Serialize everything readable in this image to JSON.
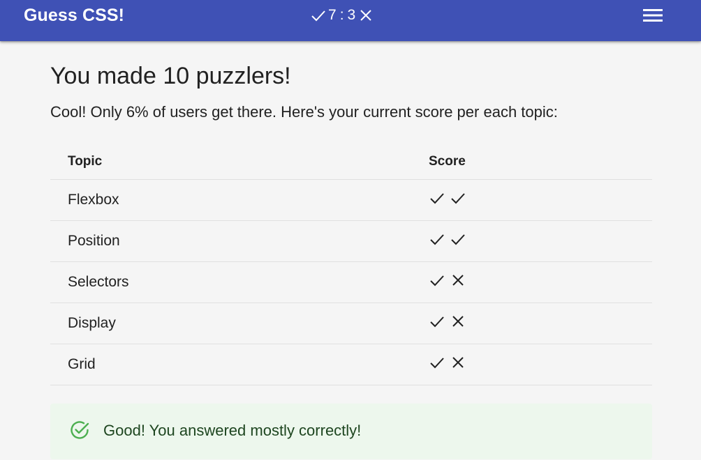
{
  "appbar": {
    "title": "Guess CSS!",
    "score_correct": "7",
    "score_separator": ":",
    "score_wrong": "3",
    "menu_icon": "hamburger-menu-icon",
    "bg_color": "#3f51b5"
  },
  "main": {
    "heading": "You made 10 puzzlers!",
    "subtitle": "Cool! Only 6% of users get there. Here's your current score per each topic:",
    "table": {
      "headers": {
        "topic": "Topic",
        "score": "Score"
      },
      "rows": [
        {
          "topic": "Flexbox",
          "marks": [
            "check",
            "check"
          ]
        },
        {
          "topic": "Position",
          "marks": [
            "check",
            "check"
          ]
        },
        {
          "topic": "Selectors",
          "marks": [
            "check",
            "cross"
          ]
        },
        {
          "topic": "Display",
          "marks": [
            "check",
            "cross"
          ]
        },
        {
          "topic": "Grid",
          "marks": [
            "check",
            "cross"
          ]
        }
      ]
    },
    "alert": {
      "icon": "check-circle-outline-icon",
      "text": "Good! You answered mostly correctly!",
      "bg_color": "#edf7ed",
      "icon_color": "#4caf50"
    }
  }
}
